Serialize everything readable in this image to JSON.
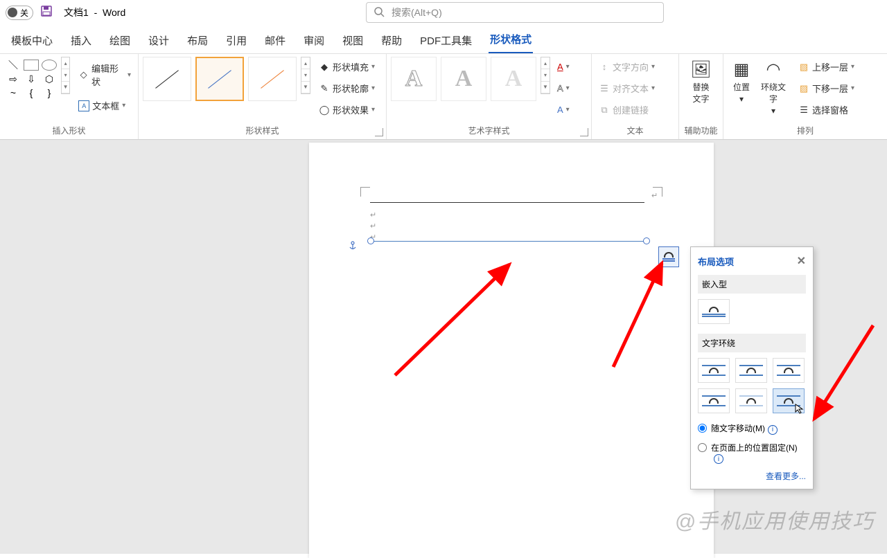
{
  "title": {
    "switch_label": "关",
    "doc": "文档1",
    "app": "Word"
  },
  "search": {
    "placeholder": "搜索(Alt+Q)"
  },
  "tabs": [
    "模板中心",
    "插入",
    "绘图",
    "设计",
    "布局",
    "引用",
    "邮件",
    "审阅",
    "视图",
    "帮助",
    "PDF工具集",
    "形状格式"
  ],
  "active_tab": "形状格式",
  "ribbon": {
    "insert_shapes": {
      "edit_shape": "编辑形状",
      "text_box": "文本框",
      "label": "插入形状"
    },
    "shape_styles": {
      "fill": "形状填充",
      "outline": "形状轮廓",
      "effects": "形状效果",
      "label": "形状样式"
    },
    "wordart": {
      "label": "艺术字样式"
    },
    "text": {
      "direction": "文字方向",
      "align": "对齐文本",
      "link": "创建链接",
      "label": "文本"
    },
    "accessibility": {
      "alt_text": "替换\n文字",
      "label": "辅助功能"
    },
    "arrange": {
      "position": "位置",
      "wrap": "环绕文\n字",
      "bring_forward": "上移一层",
      "send_backward": "下移一层",
      "selection_pane": "选择窗格",
      "label": "排列"
    }
  },
  "layout_popup": {
    "title": "布局选项",
    "inline_label": "嵌入型",
    "wrap_label": "文字环绕",
    "move_with_text": "随文字移动(M)",
    "fix_on_page": "在页面上的位置固定(N)",
    "see_more": "查看更多..."
  },
  "watermark": "@手机应用使用技巧"
}
